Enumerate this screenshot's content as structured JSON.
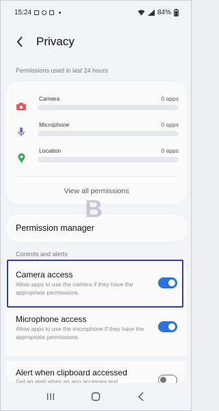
{
  "status_bar": {
    "time": "15:24",
    "battery": "84%"
  },
  "header": {
    "title": "Privacy"
  },
  "permissions_used": {
    "label": "Permissions used in last 24 hours",
    "items": [
      {
        "name": "Camera",
        "count": "0 apps",
        "icon": "camera-icon",
        "color": "#e05a5a"
      },
      {
        "name": "Microphone",
        "count": "0 apps",
        "icon": "microphone-icon",
        "color": "#6a6ad8"
      },
      {
        "name": "Location",
        "count": "0 apps",
        "icon": "location-icon",
        "color": "#3aa35a"
      }
    ],
    "view_all": "View all permissions"
  },
  "permission_manager": {
    "label": "Permission manager"
  },
  "controls": {
    "label": "Controls and alerts",
    "items": [
      {
        "title": "Camera access",
        "desc": "Allow apps to use the camera if they have the appropriate permissions.",
        "enabled": true
      },
      {
        "title": "Microphone access",
        "desc": "Allow apps to use the microphone if they have the appropriate permissions.",
        "enabled": true
      },
      {
        "title": "Alert when clipboard accessed",
        "desc": "Get an alert when an app accesses text",
        "enabled": false
      }
    ]
  },
  "watermark": "B",
  "colors": {
    "accent": "#2a73e0",
    "highlight_border": "#3040a8"
  }
}
